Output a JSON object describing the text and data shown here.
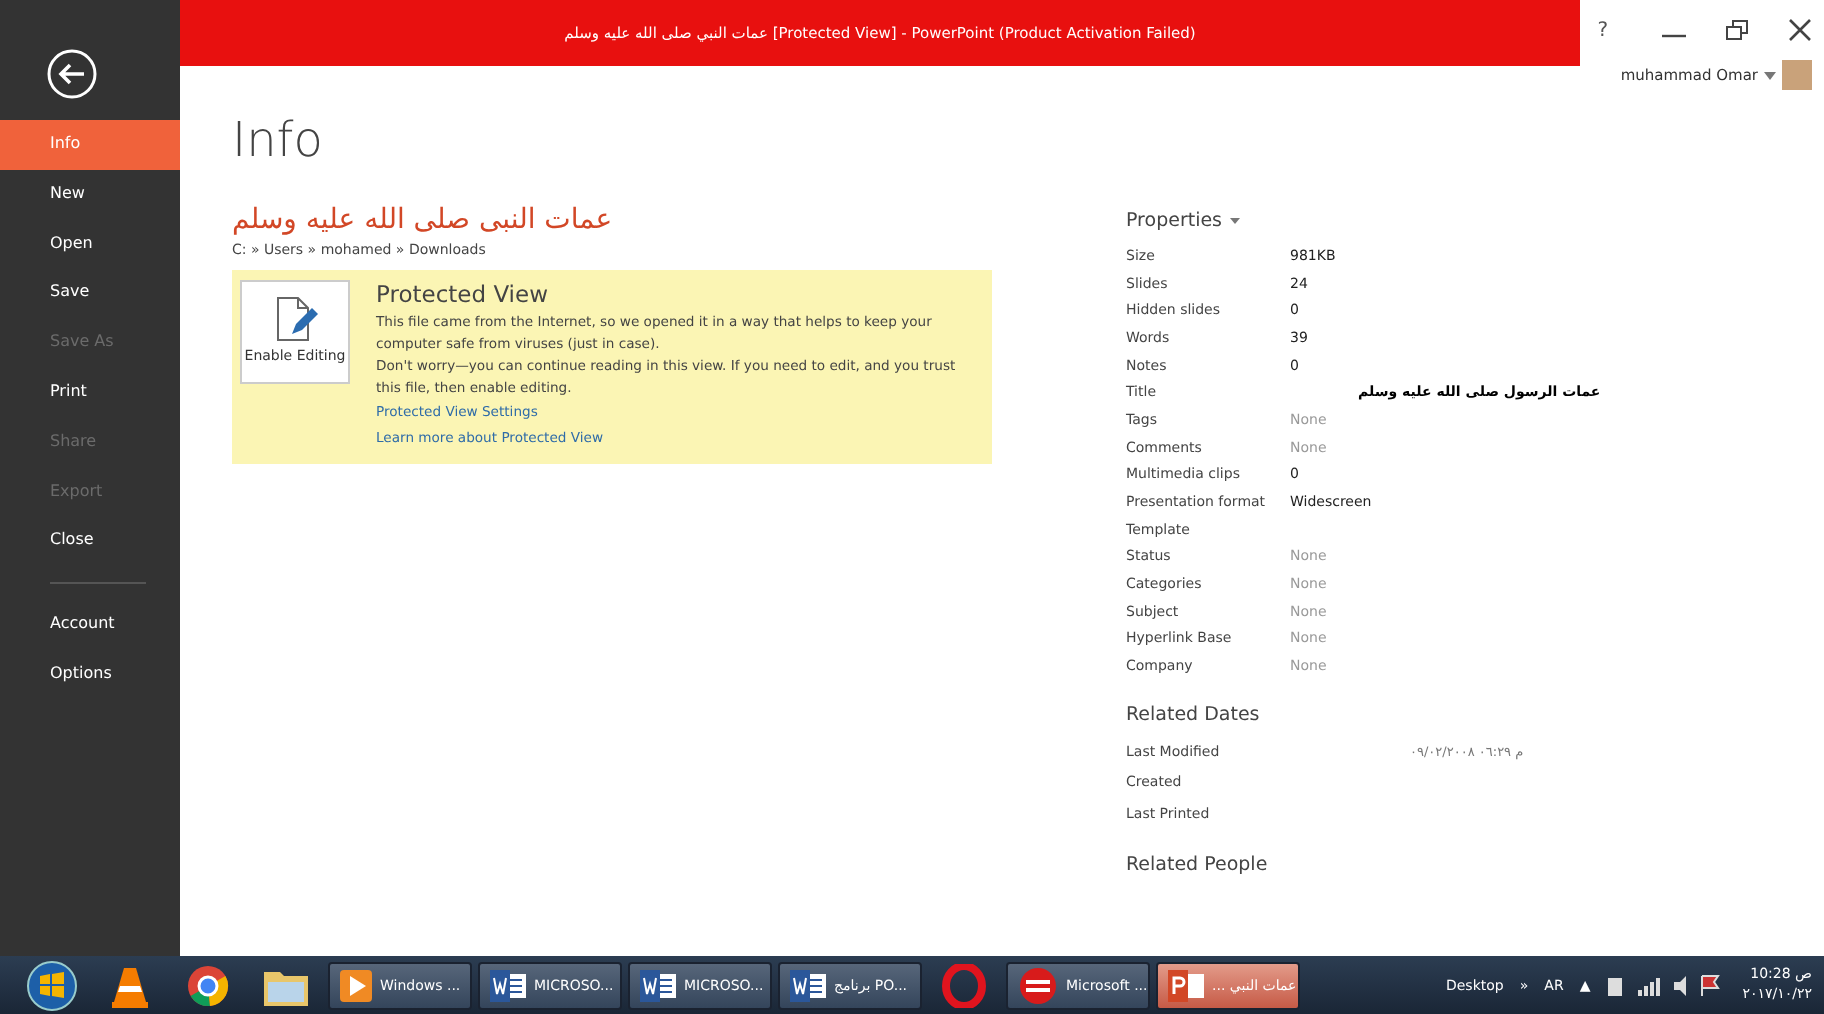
{
  "window": {
    "title": "عمات النبي صلى الله عليه وسلم [Protected View]  -  PowerPoint (Product Activation Failed)",
    "help": "?",
    "user": "muhammad Omar"
  },
  "sidebar": {
    "items": [
      {
        "label": "Info",
        "selected": true,
        "disabled": false
      },
      {
        "label": "New",
        "selected": false,
        "disabled": false
      },
      {
        "label": "Open",
        "selected": false,
        "disabled": false
      },
      {
        "label": "Save",
        "selected": false,
        "disabled": false
      },
      {
        "label": "Save As",
        "selected": false,
        "disabled": true
      },
      {
        "label": "Print",
        "selected": false,
        "disabled": false
      },
      {
        "label": "Share",
        "selected": false,
        "disabled": true
      },
      {
        "label": "Export",
        "selected": false,
        "disabled": true
      },
      {
        "label": "Close",
        "selected": false,
        "disabled": false
      }
    ],
    "bottom_items": [
      {
        "label": "Account",
        "selected": false,
        "disabled": false
      },
      {
        "label": "Options",
        "selected": false,
        "disabled": false
      }
    ]
  },
  "page": {
    "heading": "Info",
    "doc_title": "عمات النبى صلى الله عليه وسلم",
    "path": "C: » Users » mohamed » Downloads"
  },
  "protected_view": {
    "button": "Enable Editing",
    "title": "Protected View",
    "paragraphs": [
      "This file came from the Internet, so we opened it in a way that helps to keep your computer safe from viruses (just in case).",
      "Don't worry—you can continue reading in this view. If you need to edit, and you trust this file, then enable editing."
    ],
    "links": [
      "Protected View Settings",
      "Learn more about Protected View"
    ]
  },
  "properties": {
    "title": "Properties",
    "rows": [
      {
        "label": "Size",
        "value": "981KB"
      },
      {
        "label": "Slides",
        "value": "24"
      },
      {
        "label": "Hidden slides",
        "value": "0"
      },
      {
        "label": "Words",
        "value": "39"
      },
      {
        "label": "Notes",
        "value": "0"
      },
      {
        "label": "Title",
        "value": "عمات الرسول صلى الله عليه وسلم",
        "kind": "rtl"
      },
      {
        "label": "Tags",
        "placeholder": "None"
      },
      {
        "label": "Comments",
        "placeholder": "None"
      },
      {
        "label": "Multimedia clips",
        "value": "0"
      },
      {
        "label": "Presentation format",
        "value": "Widescreen"
      },
      {
        "label": "Template"
      },
      {
        "label": "Status",
        "placeholder": "None"
      },
      {
        "label": "Categories",
        "placeholder": "None"
      },
      {
        "label": "Subject",
        "placeholder": "None"
      },
      {
        "label": "Hyperlink Base",
        "placeholder": "None"
      },
      {
        "label": "Company",
        "placeholder": "None"
      }
    ]
  },
  "related_dates": {
    "title": "Related Dates",
    "rows": [
      {
        "label": "Last Modified",
        "value": "م ٠٦:٢٩ ٠٩/٠٢/٢٠٠٨"
      },
      {
        "label": "Created"
      },
      {
        "label": "Last Printed"
      }
    ]
  },
  "related_people": {
    "title": "Related People"
  },
  "taskbar": {
    "apps": [
      {
        "kind": "start"
      },
      {
        "kind": "cone"
      },
      {
        "kind": "chrome"
      },
      {
        "kind": "folder"
      },
      {
        "kind": "player",
        "label": "Windows ...",
        "selected": false
      },
      {
        "kind": "word",
        "label": "MICROSO...",
        "selected": false
      },
      {
        "kind": "word",
        "label": "MICROSO...",
        "selected": false
      },
      {
        "kind": "word",
        "label": "برنامج PO...",
        "selected": false
      },
      {
        "kind": "opera"
      },
      {
        "kind": "ringapp",
        "label": "Microsoft ...",
        "selected": false
      },
      {
        "kind": "powerpoint",
        "label": "... عمات النبي",
        "selected": true
      }
    ],
    "desktop": "Desktop",
    "chevron": "»",
    "language": "AR",
    "tray_arrow": "▲",
    "time": "10:28 ص",
    "date": "٢٠١٧/١٠/٢٢"
  }
}
